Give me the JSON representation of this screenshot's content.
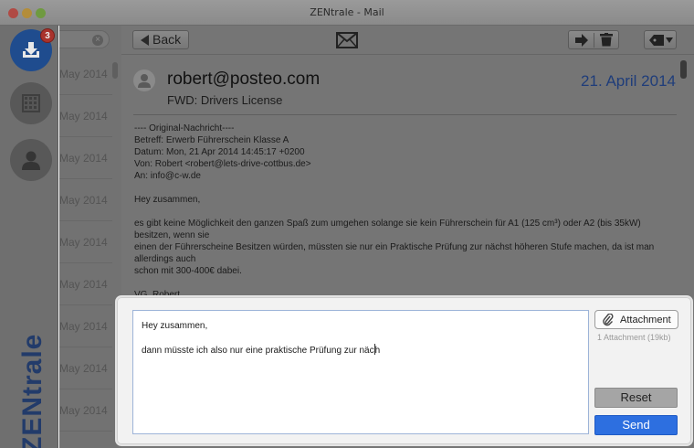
{
  "window": {
    "title": "ZENtrale - Mail"
  },
  "sidebar": {
    "inbox_badge": "3",
    "brand": "ZENtrale",
    "items": [
      {
        "icon": "download-icon"
      },
      {
        "icon": "calendar-icon"
      },
      {
        "icon": "contact-icon"
      }
    ]
  },
  "mail_list": {
    "dates": [
      "May 2014",
      "May 2014",
      "May 2014",
      "May 2014",
      "May 2014",
      "May 2014",
      "May 2014",
      "May 2014",
      "May 2014"
    ]
  },
  "toolbar": {
    "back_label": "Back"
  },
  "message": {
    "sender": "robert@posteo.com",
    "subject": "FWD: Drivers License",
    "date": "21. April 2014",
    "body": [
      "---- Original-Nachricht----",
      "Betreff: Erwerb Führerschein Klasse A",
      "Datum: Mon, 21 Apr 2014 14:45:17 +0200",
      "Von: Robert <robert@lets-drive-cottbus.de>",
      "An: info@c-w.de",
      "",
      "Hey zusammen,",
      "",
      "es gibt keine Möglichkeit den ganzen Spaß zum umgehen solange sie kein Führerschein für A1 (125 cm³) oder A2 (bis 35kW)",
      "besitzen, wenn sie",
      "einen der Führerscheine Besitzen würden, müssten sie nur ein Praktische Prüfung zur nächst höheren Stufe machen, da ist man",
      "allerdings auch",
      "schon mit 300-400€ dabei.",
      "",
      "VG, Robert"
    ]
  },
  "reply": {
    "line1": "Hey zusammen,",
    "line2": "dann müsste ich also nur eine praktische Prüfung zur näc",
    "line2_after_caret": "h",
    "attachment_label": "Attachment",
    "attachment_count": "1 Attachment (19kb)",
    "reset_label": "Reset",
    "send_label": "Send"
  },
  "colors": {
    "accent": "#2d6fe0",
    "badge": "#a9322c",
    "brand": "#223b6a",
    "date": "#1f3d7a"
  }
}
